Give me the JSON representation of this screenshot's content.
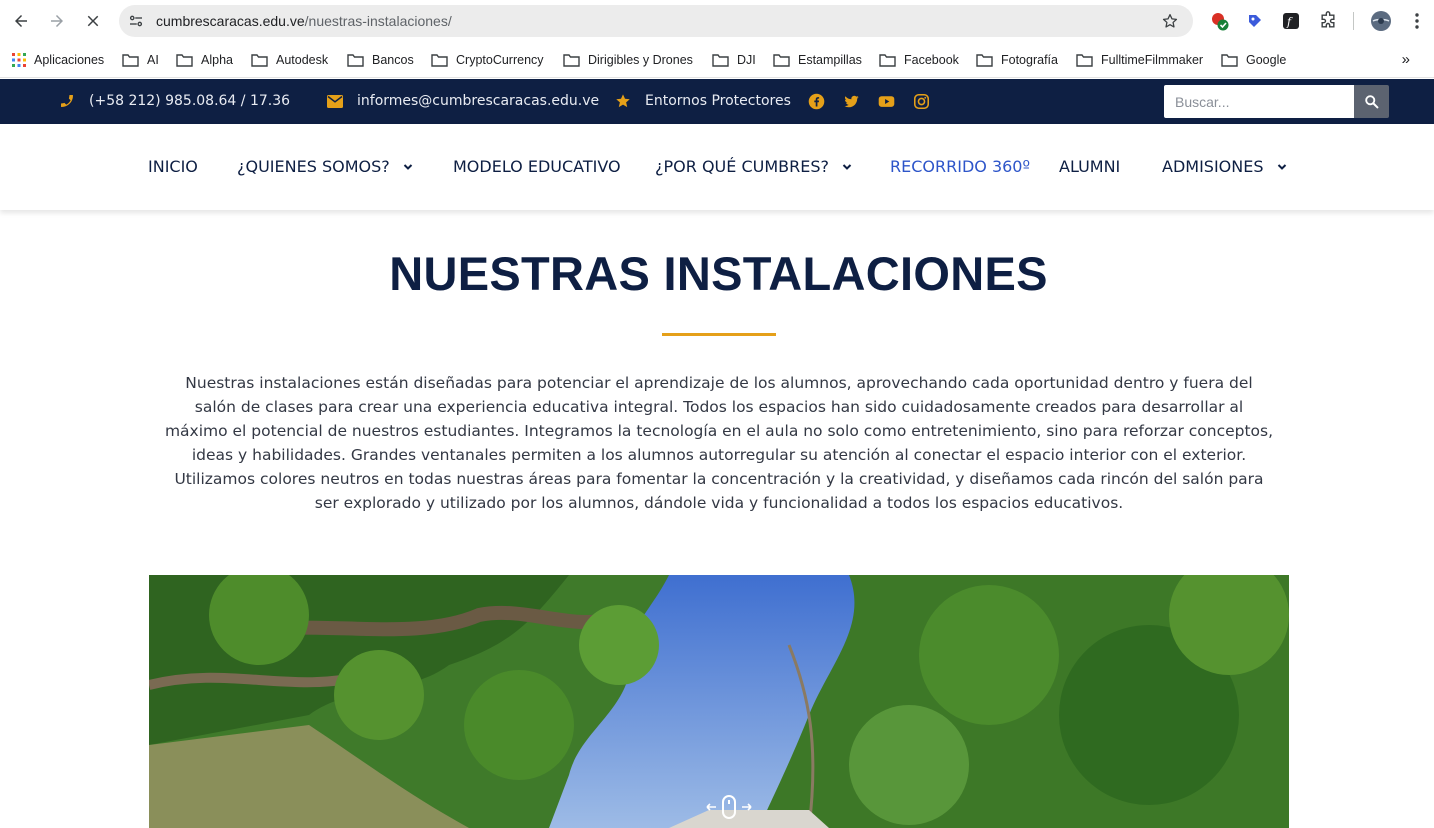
{
  "browser": {
    "url_host": "cumbrescaracas.edu.ve",
    "url_path": "/nuestras-instalaciones/",
    "bookmarks": [
      {
        "label": "Aplicaciones",
        "icon": "apps-grid-icon"
      },
      {
        "label": "AI",
        "icon": "folder-icon"
      },
      {
        "label": "Alpha",
        "icon": "folder-icon"
      },
      {
        "label": "Autodesk",
        "icon": "folder-icon"
      },
      {
        "label": "Bancos",
        "icon": "folder-icon"
      },
      {
        "label": "CryptoCurrency",
        "icon": "folder-icon"
      },
      {
        "label": "Dirigibles y Drones",
        "icon": "folder-icon"
      },
      {
        "label": "DJI",
        "icon": "folder-icon"
      },
      {
        "label": "Estampillas",
        "icon": "folder-icon"
      },
      {
        "label": "Facebook",
        "icon": "folder-icon"
      },
      {
        "label": "Fotografía",
        "icon": "folder-icon"
      },
      {
        "label": "FulltimeFilmmaker",
        "icon": "folder-icon"
      },
      {
        "label": "Google",
        "icon": "folder-icon"
      }
    ],
    "more_bookmarks": "»"
  },
  "topbar": {
    "phone": "(+58 212) 985.08.64 / 17.36",
    "email": "informes@cumbrescaracas.edu.ve",
    "protective": "Entornos Protectores",
    "social": [
      "facebook-icon",
      "twitter-icon",
      "youtube-icon",
      "instagram-icon"
    ],
    "search_placeholder": "Buscar...",
    "accent_color": "#e5a019",
    "bg_color": "#0e1f43"
  },
  "nav": {
    "items": [
      {
        "label": "INICIO",
        "dropdown": false
      },
      {
        "label": "¿QUIENES SOMOS?",
        "dropdown": true
      },
      {
        "label": "MODELO EDUCATIVO",
        "dropdown": false
      },
      {
        "label": "¿POR QUÉ CUMBRES?",
        "dropdown": true
      },
      {
        "label": "RECORRIDO 360º",
        "dropdown": false,
        "active": true
      },
      {
        "label": "ALUMNI",
        "dropdown": false
      },
      {
        "label": "ADMISIONES",
        "dropdown": true
      }
    ],
    "active_color": "#2d55c9"
  },
  "content": {
    "title": "NUESTRAS INSTALACIONES",
    "intro_lines": [
      "Nuestras instalaciones están diseñadas para potenciar el aprendizaje de los alumnos, aprovechando cada oportunidad dentro y fuera del",
      "salón de clases para crear una experiencia educativa integral. Todos los espacios han sido cuidadosamente creados para desarrollar al",
      "máximo el potencial de nuestros estudiantes. Integramos la tecnología en el aula no solo como entretenimiento, sino para reforzar conceptos,",
      "ideas y habilidades. Grandes ventanales permiten a los alumnos autorregular su atención al conectar el espacio interior con el exterior.",
      "Utilizamos colores neutros en todas nuestras áreas para fomentar la concentración y la creatividad, y diseñamos cada rincón del salón para",
      "ser explorado y utilizado por los alumnos, dándole vida y funcionalidad a todos los espacios educativos."
    ]
  }
}
